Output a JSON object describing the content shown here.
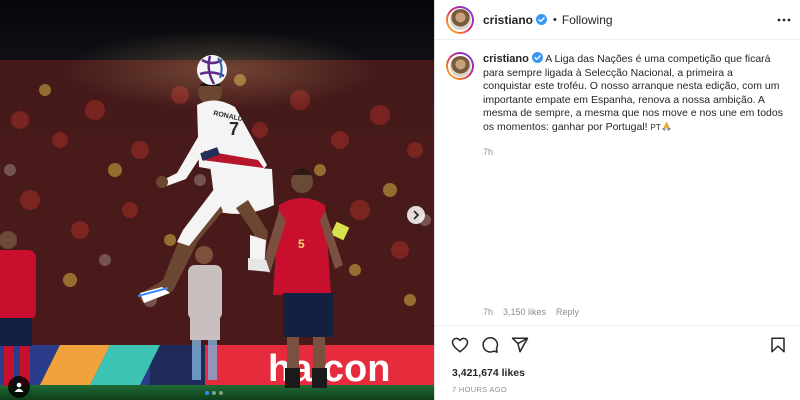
{
  "header": {
    "username": "cristiano",
    "bullet": "•",
    "follow_status": "Following",
    "icons": {
      "verified": "verified-badge-icon",
      "more": "more-options-icon"
    }
  },
  "caption": {
    "username": "cristiano",
    "text": "A Liga das Nações é uma competição que ficará para sempre ligada à Selecção Nacional, a primeira a conquistar este troféu. O nosso arranque nesta edição, com um importante empate em Espanha, renova a nossa ambição. A mesma de sempre, a mesma que nos move e nos une em todos os momentos: ganhar por Portugal!",
    "emoji_icon": "praying-hands-icon",
    "flag_text": "PT",
    "time": "7h"
  },
  "comment_meta": {
    "time": "7h",
    "likes": "3,150 likes",
    "reply": "Reply"
  },
  "actions": {
    "icons": [
      "heart-icon",
      "comment-icon",
      "share-icon",
      "bookmark-icon"
    ]
  },
  "stats": {
    "likes": "3,421,674 likes",
    "posted": "7 HOURS AGO"
  },
  "media": {
    "carousel_total": 3,
    "carousel_active": 1,
    "jersey_back_number": "7",
    "jersey_name": "RONALDO",
    "opponent_number": "5",
    "board_text": "halcon",
    "icons": {
      "next": "chevron-right-icon",
      "tags": "user-tag-icon"
    }
  },
  "colors": {
    "link": "#0095f6",
    "verified": "#3897f0",
    "meta_text": "#8e8e8e",
    "spain_red": "#c8102e",
    "portugal_white": "#f4f4f4"
  }
}
